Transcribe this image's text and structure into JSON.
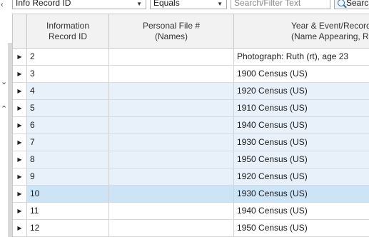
{
  "filter": {
    "field_value": "Info Record ID",
    "operator_value": "Equals",
    "search_placeholder": "Search/Filter Text",
    "search_button_label": "Searc"
  },
  "left_icons": {
    "top": "chevron-left-icon",
    "mid1": "chevron-down-icon",
    "mid2": "chevron-up-icon"
  },
  "columns": {
    "info_id_line1": "Information",
    "info_id_line2": "Record ID",
    "personal_line1": "Personal File #",
    "personal_line2": "(Names)",
    "year_line1": "Year & Event/Record",
    "year_line2": "(Name Appearing, Role/Re"
  },
  "rows": [
    {
      "id": "2",
      "event": "Photograph: Ruth (rt), age 23",
      "style": "plain"
    },
    {
      "id": "3",
      "event": "1900 Census (US)",
      "style": "plain"
    },
    {
      "id": "4",
      "event": "1920 Census (US)",
      "style": "alt"
    },
    {
      "id": "5",
      "event": "1910 Census (US)",
      "style": "alt"
    },
    {
      "id": "6",
      "event": "1940 Census (US)",
      "style": "alt"
    },
    {
      "id": "7",
      "event": "1930 Census (US)",
      "style": "alt"
    },
    {
      "id": "8",
      "event": "1950 Census (US)",
      "style": "alt"
    },
    {
      "id": "9",
      "event": "1920 Census (US)",
      "style": "alt"
    },
    {
      "id": "10",
      "event": "1930 Census (US)",
      "style": "sel"
    },
    {
      "id": "11",
      "event": "1940 Census (US)",
      "style": "plain"
    },
    {
      "id": "12",
      "event": "1950 Census (US)",
      "style": "plain"
    }
  ]
}
